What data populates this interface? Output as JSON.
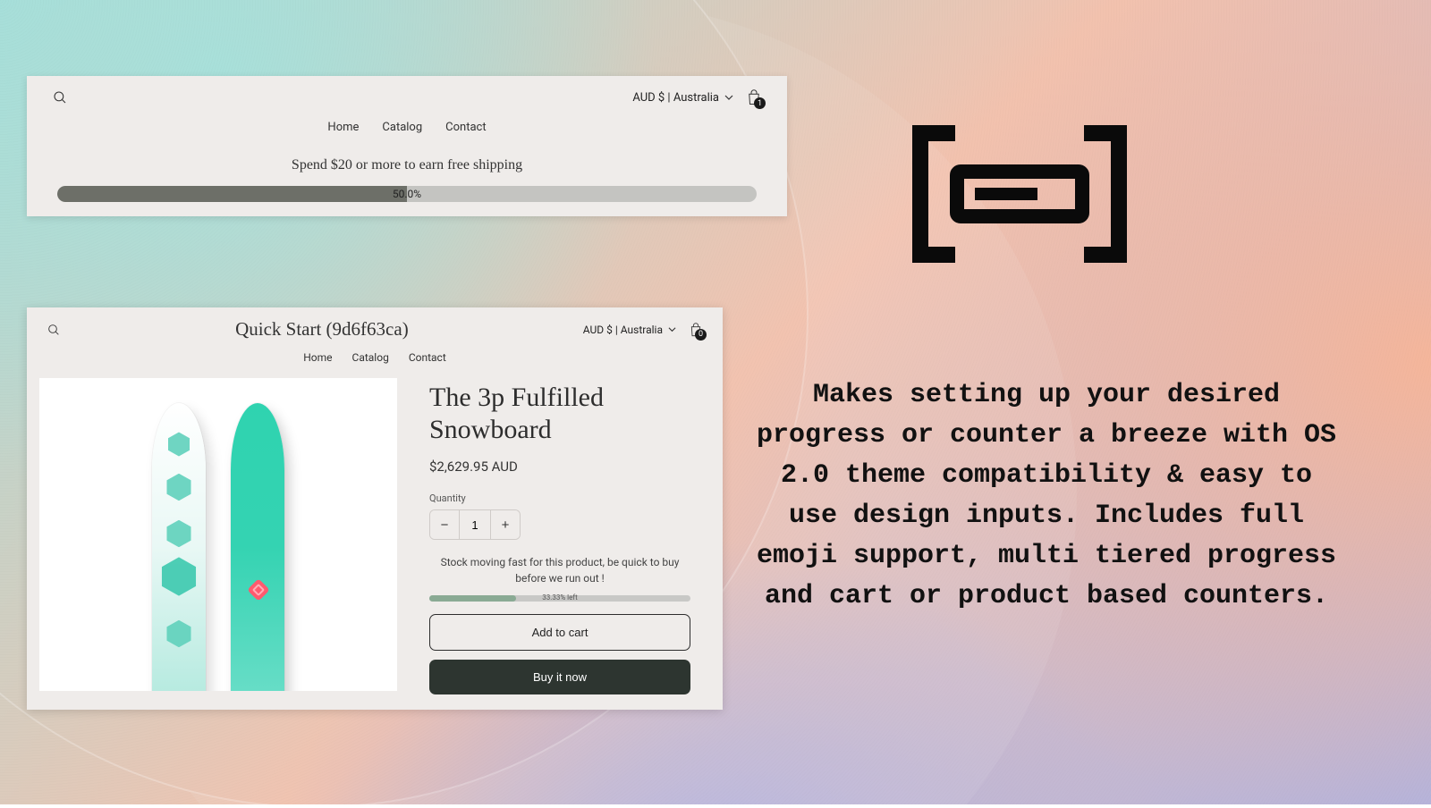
{
  "shot1": {
    "currency": "AUD $ | Australia",
    "cart_count": "1",
    "nav": [
      "Home",
      "Catalog",
      "Contact"
    ],
    "promo": "Spend $20 or more to earn free shipping",
    "progress_label": "50.0%",
    "progress_pct": 50
  },
  "shot2": {
    "store_title": "Quick Start (9d6f63ca)",
    "currency": "AUD $ | Australia",
    "cart_count": "0",
    "nav": [
      "Home",
      "Catalog",
      "Contact"
    ],
    "product_title": "The 3p Fulfilled Snowboard",
    "price": "$2,629.95 AUD",
    "qty_label": "Quantity",
    "qty_value": "1",
    "stock_msg": "Stock moving fast for this product, be quick to buy before we run out !",
    "stock_progress_label": "33.33% left",
    "stock_progress_pct": 33.33,
    "add_to_cart": "Add to cart",
    "buy_now": "Buy it now"
  },
  "marketing": "Makes setting up your desired progress or counter a breeze with OS 2.0 theme compatibility & easy to use design inputs. Includes full emoji support, multi tiered progress and cart or product based counters."
}
